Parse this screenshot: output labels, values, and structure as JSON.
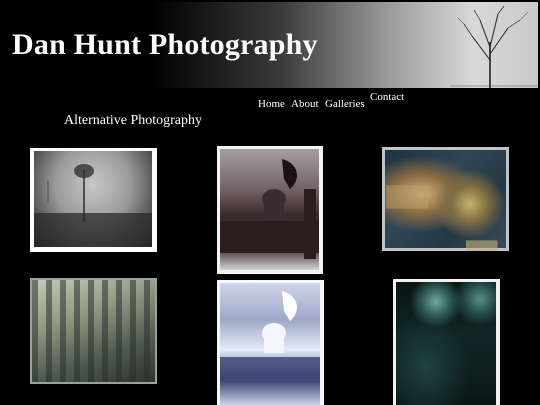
{
  "header": {
    "title": "Dan Hunt Photography"
  },
  "nav": {
    "home": "Home",
    "about": "About",
    "galleries": "Galleries",
    "contact": "Contact"
  },
  "page": {
    "heading": "Alternative Photography"
  },
  "gallery": {
    "thumbnails": [
      {
        "subject": "lone tree in fog"
      },
      {
        "subject": "rome domes with statue"
      },
      {
        "subject": "weathered sign"
      },
      {
        "subject": "building facade"
      },
      {
        "subject": "rome domes with statue inverted tones"
      },
      {
        "subject": "night street lights"
      }
    ]
  }
}
